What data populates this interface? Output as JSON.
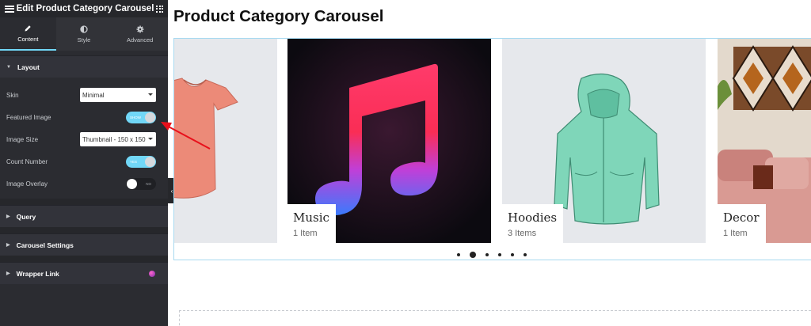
{
  "panel": {
    "title": "Edit Product Category Carousel",
    "tabs": [
      {
        "label": "Content",
        "icon": "pencil-icon"
      },
      {
        "label": "Style",
        "icon": "contrast-icon"
      },
      {
        "label": "Advanced",
        "icon": "gear-icon"
      }
    ],
    "layout": {
      "heading": "Layout",
      "skin_label": "Skin",
      "skin_value": "Minimal",
      "featured_image_label": "Featured Image",
      "featured_image_toggle": "SHOW",
      "image_size_label": "Image Size",
      "image_size_value": "Thumbnail - 150 x 150",
      "count_number_label": "Count Number",
      "count_number_toggle": "YES",
      "image_overlay_label": "Image Overlay",
      "image_overlay_toggle": "NO"
    },
    "sections": {
      "query": "Query",
      "carousel_settings": "Carousel Settings",
      "wrapper_link": "Wrapper Link"
    }
  },
  "preview": {
    "page_title": "Product Category Carousel",
    "cards": [
      {
        "name": "",
        "count": "",
        "image": "t-shirt"
      },
      {
        "name": "Music",
        "count": "1 Item",
        "image": "music-note"
      },
      {
        "name": "Hoodies",
        "count": "3 Items",
        "image": "hoodie"
      },
      {
        "name": "Decor",
        "count": "1 Item",
        "image": "decor"
      }
    ],
    "pagination": {
      "total": 6,
      "active_index": 1
    }
  },
  "colors": {
    "accent": "#71d7f7",
    "panel_bg": "#2b2c31",
    "annotation_arrow": "#e8101b"
  }
}
